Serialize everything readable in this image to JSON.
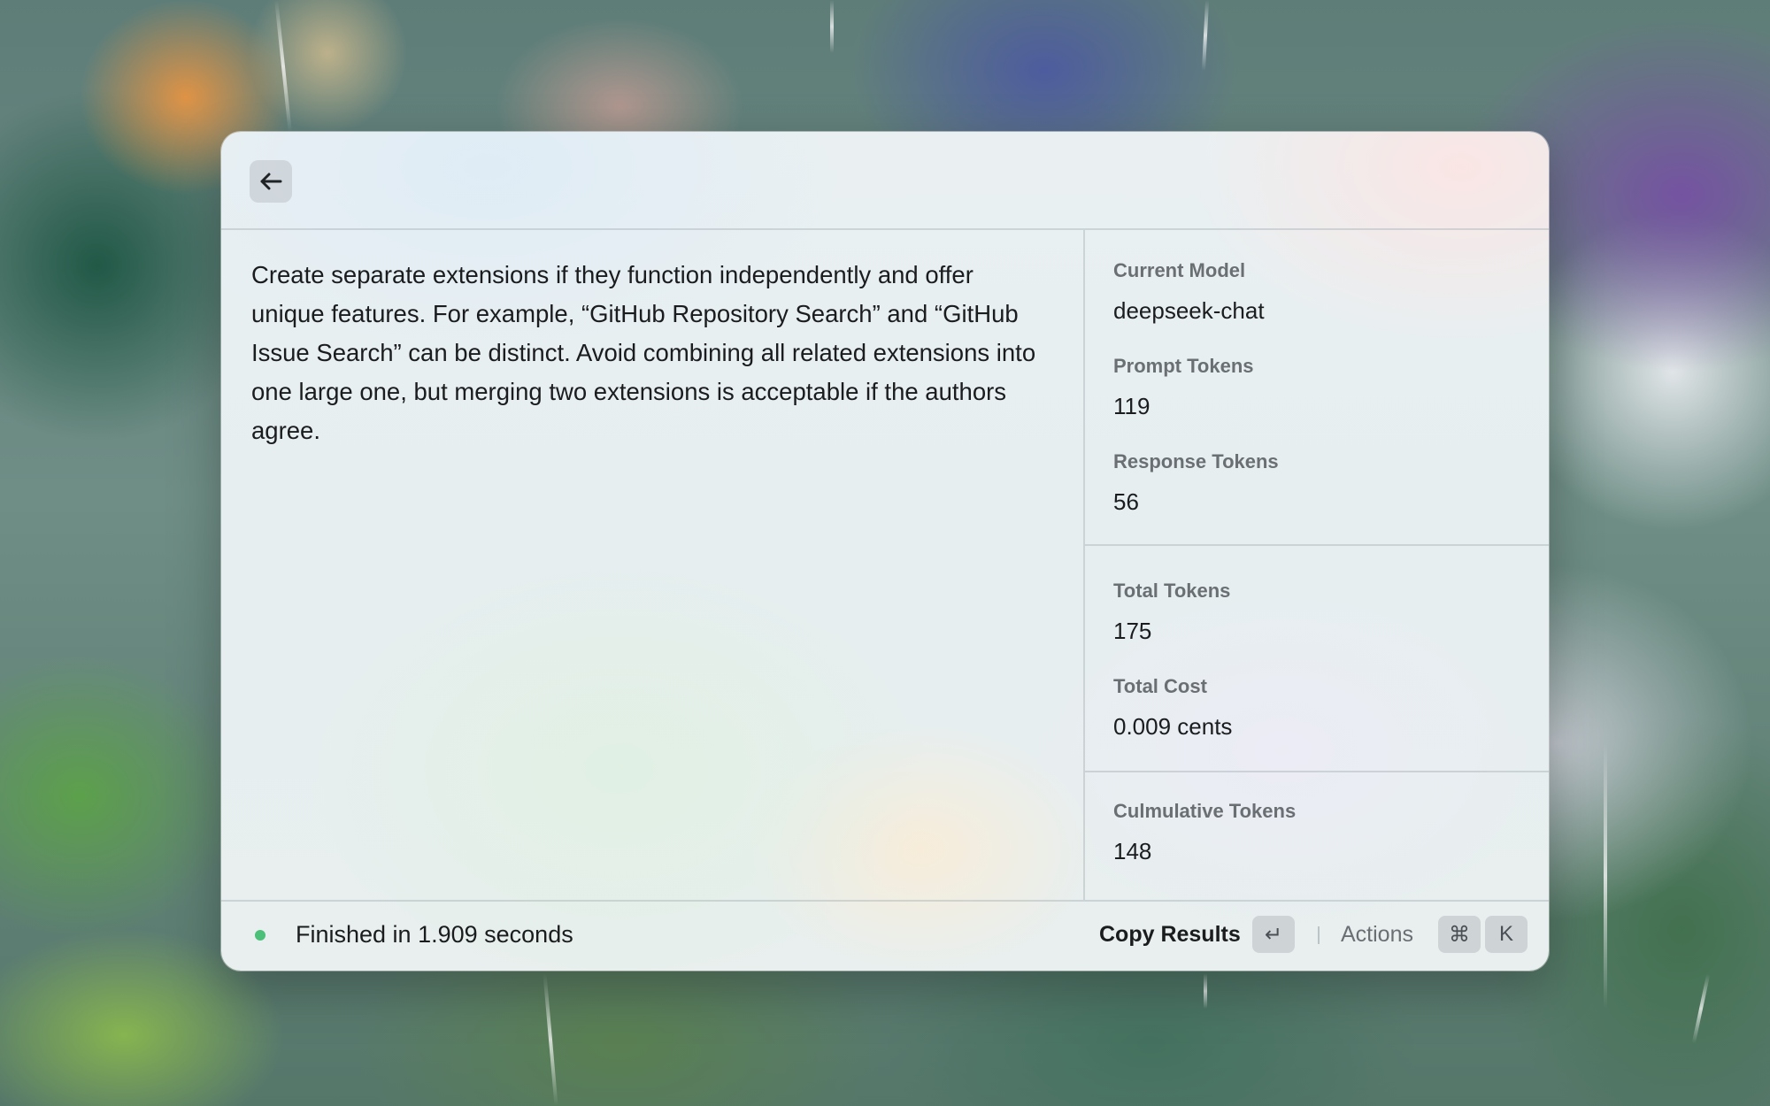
{
  "window": {
    "back_icon": "arrow-left-icon"
  },
  "result": {
    "text": "Create separate extensions if they function independently and offer unique features. For example, “GitHub Repository Search” and “GitHub Issue Search” can be distinct. Avoid combining all related extensions into one large one, but merging two extensions is acceptable if the authors agree."
  },
  "metadata": {
    "current_model_label": "Current Model",
    "current_model_value": "deepseek-chat",
    "prompt_tokens_label": "Prompt Tokens",
    "prompt_tokens_value": "119",
    "response_tokens_label": "Response Tokens",
    "response_tokens_value": "56",
    "total_tokens_label": "Total Tokens",
    "total_tokens_value": "175",
    "total_cost_label": "Total Cost",
    "total_cost_value": "0.009 cents",
    "cumulative_tokens_label": "Culmulative Tokens",
    "cumulative_tokens_value": "148"
  },
  "footer": {
    "status_text": "Finished in 1.909 seconds",
    "status_color": "#4cbf78",
    "copy_label": "Copy Results",
    "enter_key": "↵",
    "actions_label": "Actions",
    "cmd_key": "⌘",
    "k_key": "K"
  }
}
